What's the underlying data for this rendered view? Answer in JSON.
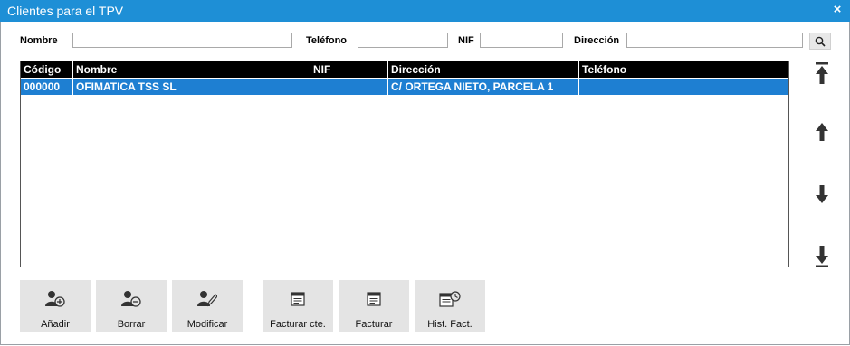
{
  "window": {
    "title": "Clientes para el TPV",
    "close_label": "×"
  },
  "filters": {
    "nombre": {
      "label": "Nombre",
      "value": ""
    },
    "telefono": {
      "label": "Teléfono",
      "value": ""
    },
    "nif": {
      "label": "NIF",
      "value": ""
    },
    "direccion": {
      "label": "Dirección",
      "value": ""
    }
  },
  "table": {
    "columns": [
      "Código",
      "Nombre",
      "NIF",
      "Dirección",
      "Teléfono"
    ],
    "rows": [
      [
        "000000",
        "OFIMATICA TSS SL",
        "",
        "C/ ORTEGA NIETO, PARCELA 1",
        ""
      ]
    ],
    "selected_color": "#1e7fd2"
  },
  "toolbar": {
    "add_label": "Añadir",
    "delete_label": "Borrar",
    "modify_label": "Modificar",
    "invoice_client_label": "Facturar cte.",
    "invoice_label": "Facturar",
    "history_label": "Hist. Fact."
  },
  "colors": {
    "titlebar": "#1e8fd6",
    "header": "#000000",
    "selected_row": "#1e7fd2"
  },
  "icons": {
    "search": "search-icon",
    "first": "arrow-to-top-icon",
    "up": "arrow-up-icon",
    "down": "arrow-down-icon",
    "last": "arrow-to-bottom-icon"
  }
}
